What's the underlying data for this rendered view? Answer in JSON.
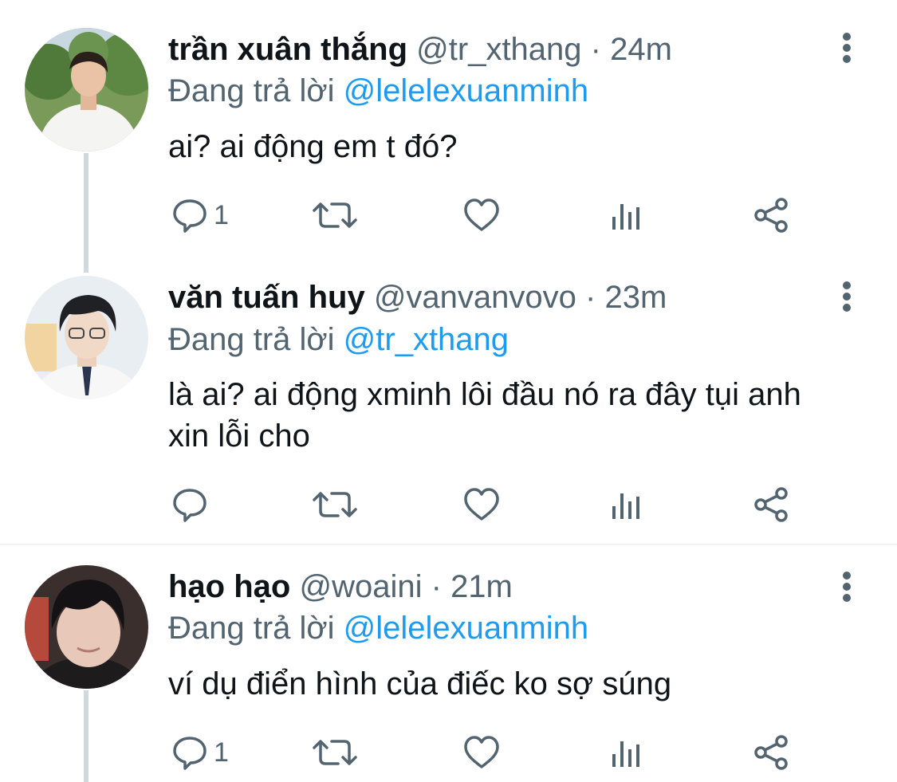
{
  "tweets": [
    {
      "name": "trần xuân thắng",
      "handle": "@tr_xthang",
      "dot": "·",
      "time": "24m",
      "replying_prefix": "Đang trả lời ",
      "replying_to": "@lelelexuanminh",
      "text": "ai? ai động em t đó?",
      "reply_count": "1"
    },
    {
      "name": "văn tuấn huy",
      "handle": "@vanvanvovo",
      "dot": "·",
      "time": "23m",
      "replying_prefix": "Đang trả lời ",
      "replying_to": "@tr_xthang",
      "text": "là ai? ai động xminh lôi đầu nó ra đây tụi anh xin lỗi cho",
      "reply_count": ""
    },
    {
      "name": "hạo hạo",
      "handle": "@woaini",
      "dot": "·",
      "time": "21m",
      "replying_prefix": "Đang trả lời ",
      "replying_to": "@lelelexuanminh",
      "text": "ví dụ điển hình của điếc ko sợ súng",
      "reply_count": "1"
    }
  ],
  "icons": {
    "more": "more-vertical-icon",
    "reply": "reply-bubble-icon",
    "retweet": "retweet-icon",
    "like": "heart-icon",
    "views": "analytics-bars-icon",
    "share": "share-icon"
  },
  "colors": {
    "text": "#0f1419",
    "secondary": "#536471",
    "link": "#1d9bf0",
    "thread_line": "#cfd9de",
    "divider": "#eff3f4"
  }
}
